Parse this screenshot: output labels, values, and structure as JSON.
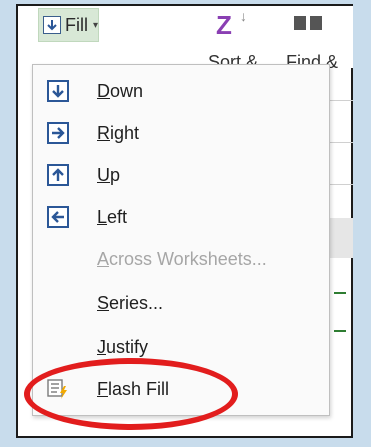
{
  "ribbon": {
    "fill_label": "Fill",
    "fill_caret": "▾",
    "sort_label": "Sort &",
    "find_label": "Find &"
  },
  "menu": {
    "items": [
      {
        "label_acc": "D",
        "label_rest": "own",
        "icon": "fill-down-icon",
        "enabled": true
      },
      {
        "label_acc": "R",
        "label_rest": "ight",
        "icon": "fill-right-icon",
        "enabled": true
      },
      {
        "label_acc": "U",
        "label_rest": "p",
        "icon": "fill-up-icon",
        "enabled": true
      },
      {
        "label_acc": "L",
        "label_rest": "eft",
        "icon": "fill-left-icon",
        "enabled": true
      },
      {
        "label_acc": "A",
        "label_rest": "cross Worksheets...",
        "icon": "",
        "enabled": false
      },
      {
        "label_acc": "S",
        "label_rest": "eries...",
        "icon": "",
        "enabled": true
      },
      {
        "label_acc": "J",
        "label_rest": "ustify",
        "icon": "",
        "enabled": true
      },
      {
        "label_acc": "F",
        "label_rest": "lash Fill",
        "icon": "flash-fill-icon",
        "enabled": true
      }
    ]
  },
  "colors": {
    "fill_button_bg": "#d8e8d6",
    "icon_blue": "#2b5797",
    "highlight_red": "#e21d1d",
    "frame_blue": "#c8dcec"
  }
}
